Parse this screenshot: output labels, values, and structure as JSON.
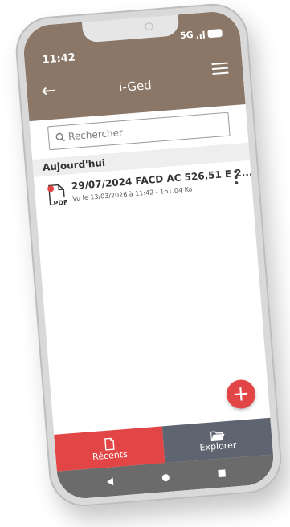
{
  "status": {
    "time": "11:42",
    "network": "5G"
  },
  "header": {
    "title": "i-Ged"
  },
  "search": {
    "placeholder": "Rechercher"
  },
  "section": {
    "label": "Aujourd'hui"
  },
  "documents": [
    {
      "title": "29/07/2024 FACD AC 526,51 E 2...",
      "subtitle": "Vu le 13/03/2026 à 11:42 - 161.04 Ko",
      "type_label": "PDF",
      "icon": "pdf-file-icon"
    }
  ],
  "fab": {
    "label": "+"
  },
  "tabs": [
    {
      "label": "Récents",
      "icon": "document-icon"
    },
    {
      "label": "Explorer",
      "icon": "folder-open-icon"
    }
  ],
  "colors": {
    "header": "#8a7767",
    "accent": "#e24545",
    "tab_inactive": "#5e6470"
  }
}
